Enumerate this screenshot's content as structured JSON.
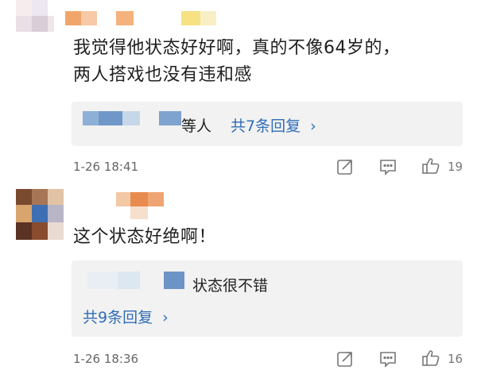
{
  "comments": [
    {
      "text_line1": "我觉得他状态好好啊，真的不像64岁的，",
      "text_line2": "两人搭戏也没有违和感",
      "reply_summary_suffix": "等人",
      "reply_count_link": "共7条回复",
      "chevron": "›",
      "time": "1-26 18:41",
      "like_count": "19"
    },
    {
      "text": "这个状态好绝啊！",
      "reply_preview_text": "状态很不错",
      "reply_count_link": "共9条回复",
      "chevron": "›",
      "time": "1-26 18:36",
      "like_count": "16"
    }
  ],
  "icons": {
    "share": "share-icon",
    "comment": "comment-icon",
    "like": "thumbs-up-icon"
  },
  "colors": {
    "link_blue": "#2f6db5",
    "reply_bg": "#f2f2f2",
    "meta_gray": "#666666"
  }
}
